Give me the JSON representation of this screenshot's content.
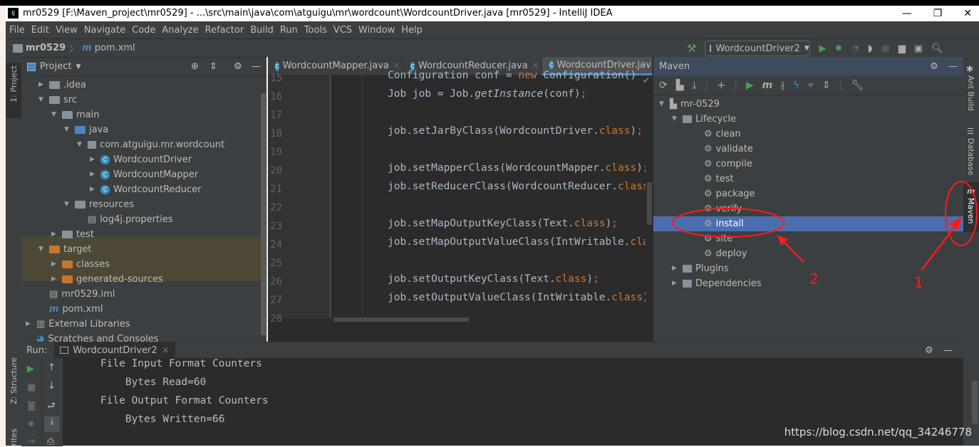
{
  "window": {
    "title": "mr0529 [F:\\Maven_project\\mr0529] - ...\\src\\main\\java\\com\\atguigu\\mr\\wordcount\\WordcountDriver.java [mr0529] - IntelliJ IDEA",
    "logo": "IJ",
    "controls": [
      "—",
      "❐",
      "✕"
    ]
  },
  "menu": [
    "File",
    "Edit",
    "View",
    "Navigate",
    "Code",
    "Analyze",
    "Refactor",
    "Build",
    "Run",
    "Tools",
    "VCS",
    "Window",
    "Help"
  ],
  "breadcrumb": {
    "project": "mr0529",
    "file": "pom.xml"
  },
  "run_config": "WordcountDriver2",
  "left_strip": {
    "project": "1: Project",
    "structure": "Z: Structure",
    "favorites": "rites"
  },
  "right_strip": [
    "Ant Build",
    "Database",
    "Maven"
  ],
  "project_panel": {
    "title": "Project",
    "tree": [
      {
        "label": ".idea",
        "depth": 1,
        "type": "folder",
        "arrow": "▶"
      },
      {
        "label": "src",
        "depth": 1,
        "type": "folder",
        "arrow": "▼"
      },
      {
        "label": "main",
        "depth": 2,
        "type": "folder",
        "arrow": "▼"
      },
      {
        "label": "java",
        "depth": 3,
        "type": "folder-blue",
        "arrow": "▼"
      },
      {
        "label": "com.atguigu.mr.wordcount",
        "depth": 4,
        "type": "package",
        "arrow": "▼"
      },
      {
        "label": "WordcountDriver",
        "depth": 5,
        "type": "class",
        "arrow": "▶"
      },
      {
        "label": "WordcountMapper",
        "depth": 5,
        "type": "class",
        "arrow": "▶"
      },
      {
        "label": "WordcountReducer",
        "depth": 5,
        "type": "class",
        "arrow": "▶"
      },
      {
        "label": "resources",
        "depth": 3,
        "type": "folder",
        "arrow": "▼"
      },
      {
        "label": "log4j.properties",
        "depth": 4,
        "type": "file",
        "arrow": ""
      },
      {
        "label": "test",
        "depth": 2,
        "type": "folder",
        "arrow": "▶"
      },
      {
        "label": "target",
        "depth": 1,
        "type": "folder-orange",
        "arrow": "▼"
      },
      {
        "label": "classes",
        "depth": 2,
        "type": "folder-orange",
        "arrow": "▶"
      },
      {
        "label": "generated-sources",
        "depth": 2,
        "type": "folder-orange",
        "arrow": "▶"
      },
      {
        "label": "mr0529.iml",
        "depth": 1,
        "type": "file",
        "arrow": ""
      },
      {
        "label": "pom.xml",
        "depth": 1,
        "type": "maven",
        "arrow": ""
      },
      {
        "label": "External Libraries",
        "depth": 0,
        "type": "lib",
        "arrow": "▶"
      },
      {
        "label": "Scratches and Consoles",
        "depth": 0,
        "type": "scratch",
        "arrow": ""
      }
    ]
  },
  "editor": {
    "tabs": [
      "WordcountMapper.java",
      "WordcountReducer.java",
      "WordcountDriver.java"
    ],
    "active_tab": 2,
    "lines": [
      {
        "n": "15",
        "code": [
          [
            "Configuration conf = ",
            ""
          ],
          [
            "new",
            "kw"
          ],
          [
            " Configuration()",
            ""
          ]
        ]
      },
      {
        "n": "16",
        "code": [
          [
            "Job job = Job.",
            ""
          ],
          [
            "getInstance",
            "it"
          ],
          [
            "(conf)",
            ""
          ],
          [
            ";",
            "kw"
          ]
        ]
      },
      {
        "n": "17",
        "code": []
      },
      {
        "n": "18",
        "code": [
          [
            "job.setJarByClass(WordcountDriver.",
            ""
          ],
          [
            "class",
            "kw"
          ],
          [
            ")",
            ""
          ],
          [
            ";",
            "kw"
          ]
        ]
      },
      {
        "n": "19",
        "code": []
      },
      {
        "n": "20",
        "code": [
          [
            "job.setMapperClass(WordcountMapper.",
            ""
          ],
          [
            "class",
            "kw"
          ],
          [
            ");",
            ""
          ]
        ]
      },
      {
        "n": "21",
        "code": [
          [
            "job.setReducerClass(WordcountReducer.",
            ""
          ],
          [
            "class",
            "kw"
          ]
        ]
      },
      {
        "n": "22",
        "code": []
      },
      {
        "n": "23",
        "code": [
          [
            "job.setMapOutputKeyClass(Text.",
            ""
          ],
          [
            "class",
            "kw"
          ],
          [
            ")",
            ""
          ],
          [
            ";",
            "kw"
          ]
        ]
      },
      {
        "n": "24",
        "code": [
          [
            "job.setMapOutputValueClass(IntWritable.",
            ""
          ],
          [
            "cla",
            "kw"
          ]
        ]
      },
      {
        "n": "25",
        "code": []
      },
      {
        "n": "26",
        "code": [
          [
            "job.setOutputKeyClass(Text.",
            ""
          ],
          [
            "class",
            "kw"
          ],
          [
            ")",
            ""
          ],
          [
            ";",
            "kw"
          ]
        ]
      },
      {
        "n": "27",
        "code": [
          [
            "job.setOutputValueClass(IntWritable.",
            ""
          ],
          [
            "class",
            "kw"
          ],
          [
            ")",
            ""
          ]
        ]
      },
      {
        "n": "28",
        "code": []
      }
    ]
  },
  "maven": {
    "title": "Maven",
    "tree": [
      {
        "label": "mr-0529",
        "depth": 0,
        "arrow": "▼",
        "type": "project"
      },
      {
        "label": "Lifecycle",
        "depth": 1,
        "arrow": "▼",
        "type": "folder"
      },
      {
        "label": "clean",
        "depth": 2,
        "type": "goal"
      },
      {
        "label": "validate",
        "depth": 2,
        "type": "goal"
      },
      {
        "label": "compile",
        "depth": 2,
        "type": "goal"
      },
      {
        "label": "test",
        "depth": 2,
        "type": "goal"
      },
      {
        "label": "package",
        "depth": 2,
        "type": "goal"
      },
      {
        "label": "verify",
        "depth": 2,
        "type": "goal"
      },
      {
        "label": "install",
        "depth": 2,
        "type": "goal",
        "selected": true
      },
      {
        "label": "site",
        "depth": 2,
        "type": "goal"
      },
      {
        "label": "deploy",
        "depth": 2,
        "type": "goal"
      },
      {
        "label": "Plugins",
        "depth": 1,
        "arrow": "▶",
        "type": "folder"
      },
      {
        "label": "Dependencies",
        "depth": 1,
        "arrow": "▶",
        "type": "folder"
      }
    ],
    "selected_color": "#4b6eaf"
  },
  "run": {
    "label": "Run:",
    "tab": "WordcountDriver2",
    "output": [
      "    File Input Format Counters",
      "        Bytes Read=60",
      "    File Output Format Counters",
      "        Bytes Written=66"
    ]
  },
  "annotations": {
    "label1": "1",
    "label2": "2",
    "color": "#ff1a1a"
  },
  "watermark": "https://blog.csdn.net/qq_34246778"
}
